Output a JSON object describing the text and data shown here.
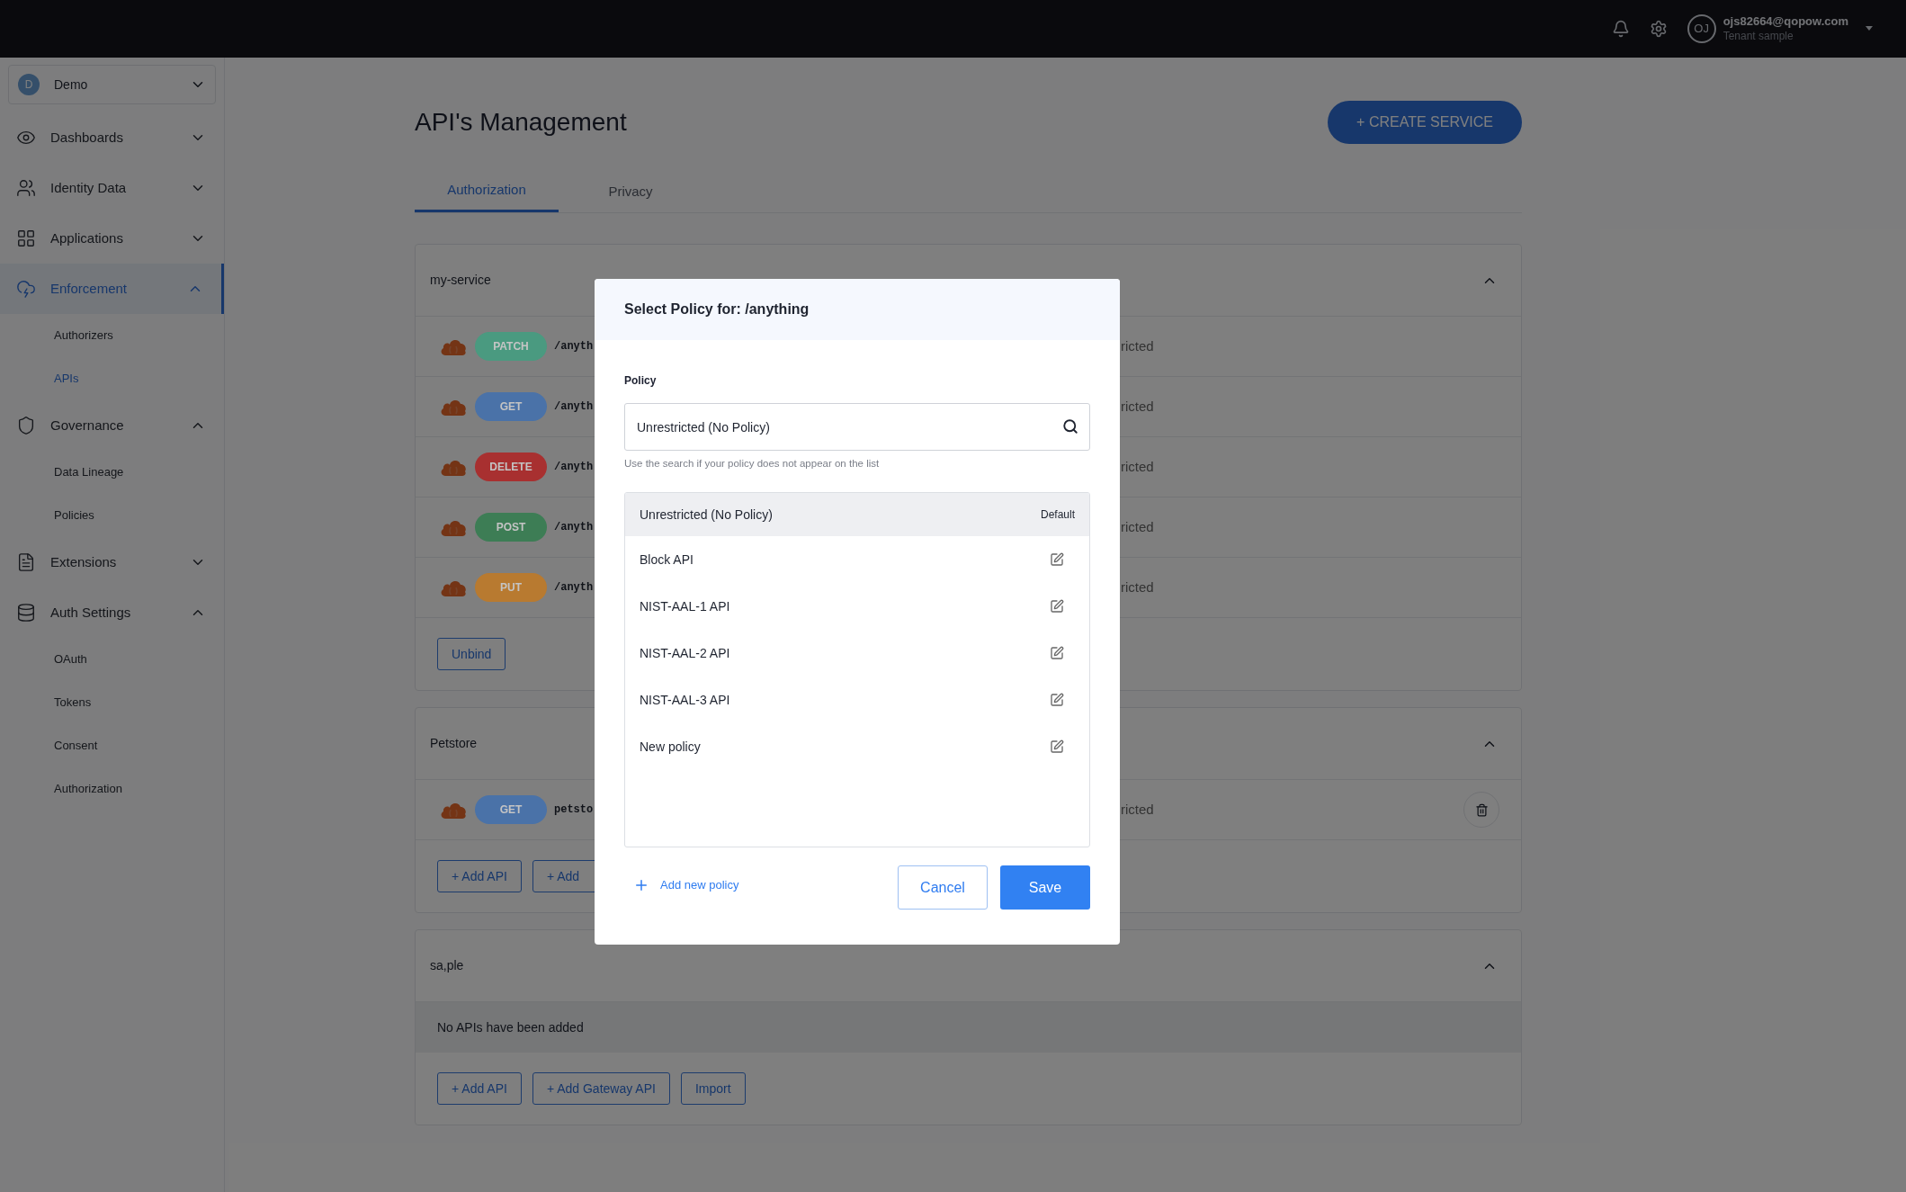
{
  "topbar": {
    "avatar": "OJ",
    "email": "ojs82664@qopow.com",
    "tenant": "Tenant sample"
  },
  "sidebar": {
    "workspace": {
      "initial": "D",
      "name": "Demo"
    },
    "items": [
      {
        "label": "Dashboards",
        "expanded": false,
        "selected": false
      },
      {
        "label": "Identity Data",
        "expanded": false,
        "selected": false
      },
      {
        "label": "Applications",
        "expanded": false,
        "selected": false
      },
      {
        "label": "Enforcement",
        "expanded": true,
        "selected": true,
        "children": [
          {
            "label": "Authorizers",
            "selected": false
          },
          {
            "label": "APIs",
            "selected": true
          }
        ]
      },
      {
        "label": "Governance",
        "expanded": true,
        "selected": false,
        "children": [
          {
            "label": "Data Lineage",
            "selected": false
          },
          {
            "label": "Policies",
            "selected": false
          }
        ]
      },
      {
        "label": "Extensions",
        "expanded": false,
        "selected": false
      },
      {
        "label": "Auth Settings",
        "expanded": true,
        "selected": false,
        "children": [
          {
            "label": "OAuth",
            "selected": false
          },
          {
            "label": "Tokens",
            "selected": false
          },
          {
            "label": "Consent",
            "selected": false
          },
          {
            "label": "Authorization",
            "selected": false
          }
        ]
      }
    ]
  },
  "page": {
    "title": "API's Management",
    "create_button": "+ CREATE SERVICE",
    "tabs": [
      {
        "label": "Authorization",
        "selected": true
      },
      {
        "label": "Privacy",
        "selected": false
      }
    ]
  },
  "services": [
    {
      "name": "my-service",
      "expanded": true,
      "rows": [
        {
          "method": "PATCH",
          "color": "#4a9a80",
          "path": "/anyth",
          "policy": "ricted",
          "deletable": false
        },
        {
          "method": "GET",
          "color": "#4a72a8",
          "path": "/anyth",
          "policy": "ricted",
          "deletable": false
        },
        {
          "method": "DELETE",
          "color": "#a83030",
          "path": "/anyth",
          "policy": "ricted",
          "deletable": false
        },
        {
          "method": "POST",
          "color": "#3d7d55",
          "path": "/anyth",
          "policy": "ricted",
          "deletable": false
        },
        {
          "method": "PUT",
          "color": "#b87a30",
          "path": "/anyth",
          "policy": "ricted",
          "deletable": false
        }
      ],
      "buttons": [
        "Unbind"
      ]
    },
    {
      "name": "Petstore",
      "expanded": true,
      "rows": [
        {
          "method": "GET",
          "color": "#4a72a8",
          "path": "petsto",
          "policy": "ricted",
          "deletable": true
        }
      ],
      "buttons": [
        "+ Add API",
        "+ Add"
      ]
    },
    {
      "name": "sa,ple",
      "expanded": true,
      "empty": "No APIs have been added",
      "buttons": [
        "+ Add API",
        "+ Add Gateway API",
        "Import"
      ]
    }
  ],
  "dialog": {
    "title": "Select Policy for: /anything",
    "field_label": "Policy",
    "value": "Unrestricted (No Policy)",
    "hint": "Use the search if your policy does not appear on the list",
    "options": [
      {
        "label": "Unrestricted (No Policy)",
        "kind": "default",
        "tag": "Default",
        "selected": true
      },
      {
        "label": "Block API",
        "kind": "editable",
        "selected": false
      },
      {
        "label": "NIST-AAL-1 API",
        "kind": "editable",
        "selected": false
      },
      {
        "label": "NIST-AAL-2 API",
        "kind": "editable",
        "selected": false
      },
      {
        "label": "NIST-AAL-3 API",
        "kind": "editable",
        "selected": false
      },
      {
        "label": "New policy",
        "kind": "editable",
        "selected": false
      }
    ],
    "add_link": "Add new policy",
    "cancel": "Cancel",
    "save": "Save"
  }
}
